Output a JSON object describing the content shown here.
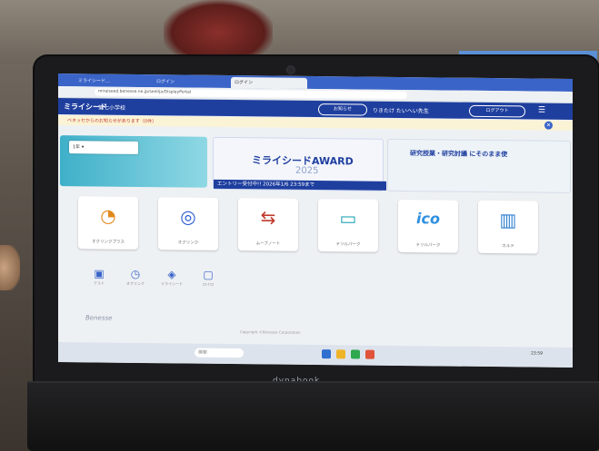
{
  "browser": {
    "tabs": [
      "ログイン",
      "ミライシード…",
      "ログイン"
    ],
    "address": "miraiseed.benesse.ne.jp/seel/ja/DisplayPortal"
  },
  "site": {
    "logo": "ミライシード",
    "school": "第七小学校",
    "notice_button": "お知らせ",
    "user": "りきたけ たいへい先生",
    "logout_button": "ログアウト",
    "menu_icon": "menu-icon",
    "notice_text": "ベネッセからのお知らせがあります（0件）"
  },
  "banners": {
    "grade_select": "1年",
    "award_title": "ミライシードAWARD",
    "award_year": "2025",
    "award_entry": "エントリー受付中!! 2026年1/6 23:59まで",
    "right_text": "研究授業・研究討議 にそのまま使"
  },
  "tiles": [
    {
      "label": "オクリンクプラス",
      "icon": "clock-icon",
      "color": "#e08a1e"
    },
    {
      "label": "オクリンク",
      "icon": "network-icon",
      "color": "#2f5fd0"
    },
    {
      "label": "ムーブノート",
      "icon": "arrows-icon",
      "color": "#c0392b"
    },
    {
      "label": "ドリルパーク",
      "icon": "tablet-icon",
      "color": "#2aa6b8"
    },
    {
      "label": "ドリルパーク",
      "icon": "ico-icon",
      "color": "#2f8fe0"
    },
    {
      "label": "カルテ",
      "icon": "chart-icon",
      "color": "#2f7fd0"
    }
  ],
  "small_tiles": [
    "テスト",
    "オクリンク",
    "ミライシード",
    "ロイロ"
  ],
  "footer": {
    "brand": "Benesse",
    "copyright": "Copyright ©Benesse Corporation"
  },
  "taskbar": {
    "search": "検索",
    "time": "23:59"
  },
  "laptop_brand": "dynabook"
}
